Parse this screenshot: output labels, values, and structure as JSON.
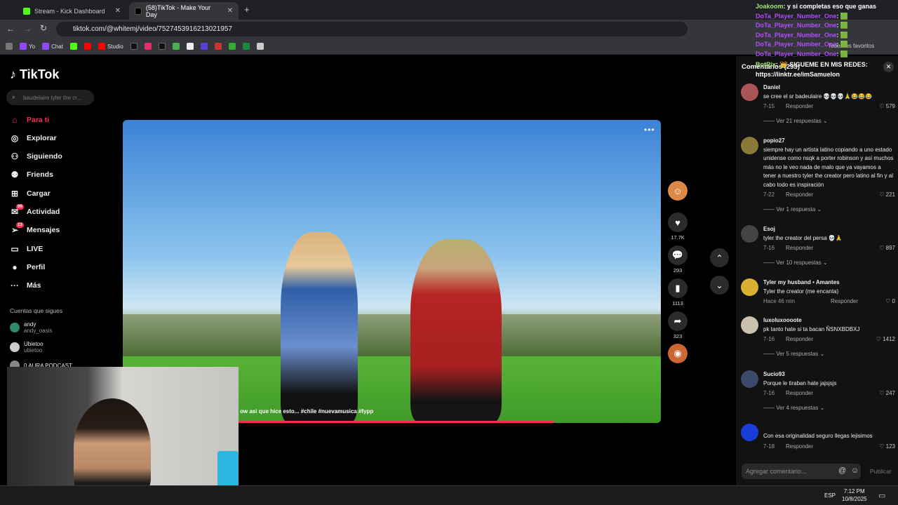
{
  "browser": {
    "tabs": [
      {
        "label": "Stream - Kick Dashboard",
        "active": false
      },
      {
        "label": "(58)TikTok - Make Your Day",
        "active": true
      }
    ],
    "url": "tiktok.com/@whitemj/video/7527453916213021957",
    "bookmarks": [
      "Yo",
      "Chat",
      "Studio"
    ],
    "all_bookmarks": "Todos los favoritos"
  },
  "sidebar": {
    "logo": "TikTok",
    "search_placeholder": "baudelaire tyler the cr...",
    "nav": [
      {
        "label": "Para ti",
        "icon": "home-icon",
        "active": true
      },
      {
        "label": "Explorar",
        "icon": "compass-icon"
      },
      {
        "label": "Siguiendo",
        "icon": "following-icon"
      },
      {
        "label": "Friends",
        "icon": "friends-icon"
      },
      {
        "label": "Cargar",
        "icon": "upload-icon"
      },
      {
        "label": "Actividad",
        "icon": "activity-icon",
        "badge": "99"
      },
      {
        "label": "Mensajes",
        "icon": "messages-icon",
        "badge": "13"
      },
      {
        "label": "LIVE",
        "icon": "live-icon"
      },
      {
        "label": "Perfil",
        "icon": "profile-icon"
      },
      {
        "label": "Más",
        "icon": "more-icon"
      }
    ],
    "follows_title": "Cuentas que sigues",
    "follows": [
      {
        "name": "andy",
        "handle": "andy_oasis"
      },
      {
        "name": "Ubietoo",
        "handle": "ubietoo"
      },
      {
        "name": "0 AURA PODCAST",
        "handle": ""
      }
    ]
  },
  "video": {
    "caption": "ow asi que hice esto... #chile #nuevamusica #fypp",
    "actions": {
      "likes": "17.7K",
      "comments": "293",
      "saves": "1113",
      "shares": "323"
    }
  },
  "comments_panel": {
    "title": "Comentarios (293)",
    "items": [
      {
        "user": "Daniel",
        "text": "se cree el sr badeulaire 💀💀💀🙏😂😂😂",
        "date": "7-15",
        "reply": "Responder",
        "likes": "579",
        "more": "Ver 21 respuestas"
      },
      {
        "user": "popio27",
        "text": "siempre hay un artista latino copiando a uno estado unidense como nsqk a porter robinson y así muchos más no le veo nada de malo que ya vayamos a tener a nuestro tyler the creator pero latino al fin y al cabo todo es inspiración",
        "date": "7-22",
        "reply": "Responder",
        "likes": "221",
        "more": "Ver 1 respuesta"
      },
      {
        "user": "Esoj",
        "text": "tyler the creator del persa 💀🙏",
        "date": "7-16",
        "reply": "Responder",
        "likes": "897",
        "more": "Ver 10 respuestas"
      },
      {
        "user": "Tyler my husband • Amantes",
        "text": "Tyler the creator (me encanta)",
        "date": "Hace 46 min",
        "reply": "Responder",
        "likes": "0",
        "more": ""
      },
      {
        "user": "luxoluxoooote",
        "text": "pk tanto hate si ta bacan ÑSNXBDBXJ",
        "date": "7-16",
        "reply": "Responder",
        "likes": "1412",
        "more": "Ver 5 respuestas"
      },
      {
        "user": "Sucio93",
        "text": "Porque le tiraban hate jajsjsjs",
        "date": "7-16",
        "reply": "Responder",
        "likes": "247",
        "more": "Ver 4 respuestas"
      },
      {
        "user": "",
        "text": "Con esa originalidad seguro llegas lejisimos",
        "date": "7-18",
        "reply": "Responder",
        "likes": "123",
        "more": ""
      }
    ],
    "input_placeholder": "Agregar comentario...",
    "publish": "Publicar"
  },
  "chat": [
    {
      "user": "Joakoom",
      "text": "y si completas eso que ganas",
      "style": "mine"
    },
    {
      "user": "DoTa_Player_Number_One",
      "text": "🟩",
      "style": "u2"
    },
    {
      "user": "DoTa_Player_Number_One",
      "text": "🟩",
      "style": "u2"
    },
    {
      "user": "DoTa_Player_Number_One",
      "text": "🟩",
      "style": "u2"
    },
    {
      "user": "DoTa_Player_Number_One",
      "text": "🟩",
      "style": "u2"
    },
    {
      "user": "DoTa_Player_Number_One",
      "text": "🟩",
      "style": "u2"
    },
    {
      "user": "BotRix",
      "text": "👑 SIGUEME EN MIS REDES: https://linktr.ee/imSamuelon",
      "style": "u1"
    }
  ],
  "taskbar": {
    "lang": "ESP",
    "time": "7:12 PM",
    "date": "10/8/2025"
  }
}
